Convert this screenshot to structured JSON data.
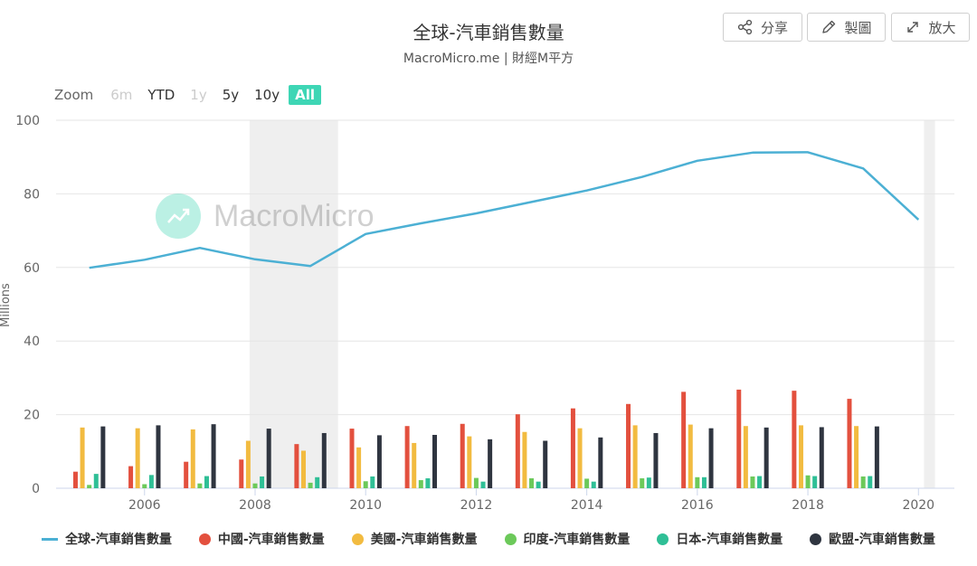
{
  "header": {
    "title": "全球-汽車銷售數量",
    "subtitle": "MacroMicro.me | 財經M平方"
  },
  "toolbar": {
    "share_label": "分享",
    "draw_label": "製圖",
    "expand_label": "放大"
  },
  "zoom": {
    "label": "Zoom",
    "options": [
      {
        "label": "6m",
        "state": "disabled"
      },
      {
        "label": "YTD",
        "state": "normal"
      },
      {
        "label": "1y",
        "state": "disabled"
      },
      {
        "label": "5y",
        "state": "normal"
      },
      {
        "label": "10y",
        "state": "normal"
      },
      {
        "label": "All",
        "state": "active"
      }
    ]
  },
  "watermark": {
    "text": "MacroMicro"
  },
  "colors": {
    "global": "#4cb0d4",
    "china": "#e3503e",
    "usa": "#f2bb40",
    "india": "#6cc95a",
    "japan": "#2fbf96",
    "eu": "#2f3540",
    "accent": "#3ed6b5"
  },
  "chart_data": {
    "type": "bar",
    "ylabel": "Millions",
    "ylim": [
      0,
      100
    ],
    "yticks": [
      0,
      20,
      40,
      60,
      80,
      100
    ],
    "xticks": [
      "2006",
      "2008",
      "2010",
      "2012",
      "2014",
      "2016",
      "2018",
      "2020"
    ],
    "x": [
      2005,
      2006,
      2007,
      2008,
      2009,
      2010,
      2011,
      2012,
      2013,
      2014,
      2015,
      2016,
      2017,
      2018,
      2019,
      2020
    ],
    "xlim": [
      2004.4,
      2020.65
    ],
    "recession_bands": [
      [
        2007.9,
        2009.5
      ],
      [
        2020.1,
        2020.3
      ]
    ],
    "grid": true,
    "legend_position": "bottom",
    "line_series": {
      "name": "全球-汽車銷售數量",
      "values": [
        59.9,
        62.1,
        65.3,
        62.2,
        60.4,
        69.1,
        72.0,
        74.7,
        77.8,
        80.9,
        84.6,
        89.0,
        91.2,
        91.3,
        86.9,
        73.0
      ]
    },
    "bar_series": [
      {
        "name": "中國-汽車銷售數量",
        "key": "china",
        "values": [
          4.5,
          6.0,
          7.2,
          7.8,
          12.0,
          16.2,
          16.9,
          17.5,
          20.1,
          21.7,
          22.9,
          26.2,
          26.8,
          26.5,
          24.3,
          null
        ]
      },
      {
        "name": "美國-汽車銷售數量",
        "key": "usa",
        "values": [
          16.5,
          16.3,
          16.0,
          12.9,
          10.2,
          11.1,
          12.3,
          14.1,
          15.3,
          16.3,
          17.1,
          17.3,
          16.9,
          17.1,
          16.9,
          null
        ]
      },
      {
        "name": "印度-汽車銷售數量",
        "key": "india",
        "values": [
          0.9,
          1.1,
          1.3,
          1.3,
          1.5,
          1.9,
          2.2,
          2.8,
          2.7,
          2.6,
          2.7,
          3.0,
          3.2,
          3.5,
          3.2,
          null
        ]
      },
      {
        "name": "日本-汽車銷售數量",
        "key": "japan",
        "values": [
          3.9,
          3.6,
          3.3,
          3.2,
          3.0,
          3.2,
          2.7,
          1.8,
          1.8,
          1.8,
          2.9,
          3.0,
          3.3,
          3.3,
          3.3,
          null
        ]
      },
      {
        "name": "歐盟-汽車銷售數量",
        "key": "eu",
        "values": [
          16.8,
          17.1,
          17.4,
          16.2,
          15.0,
          14.4,
          14.5,
          13.3,
          12.9,
          13.8,
          15.0,
          16.3,
          16.5,
          16.6,
          16.8,
          null
        ]
      }
    ]
  },
  "legend": [
    {
      "label": "全球-汽車銷售數量",
      "key": "global",
      "shape": "line"
    },
    {
      "label": "中國-汽車銷售數量",
      "key": "china",
      "shape": "dot"
    },
    {
      "label": "美國-汽車銷售數量",
      "key": "usa",
      "shape": "dot"
    },
    {
      "label": "印度-汽車銷售數量",
      "key": "india",
      "shape": "dot"
    },
    {
      "label": "日本-汽車銷售數量",
      "key": "japan",
      "shape": "dot"
    },
    {
      "label": "歐盟-汽車銷售數量",
      "key": "eu",
      "shape": "dot"
    }
  ]
}
